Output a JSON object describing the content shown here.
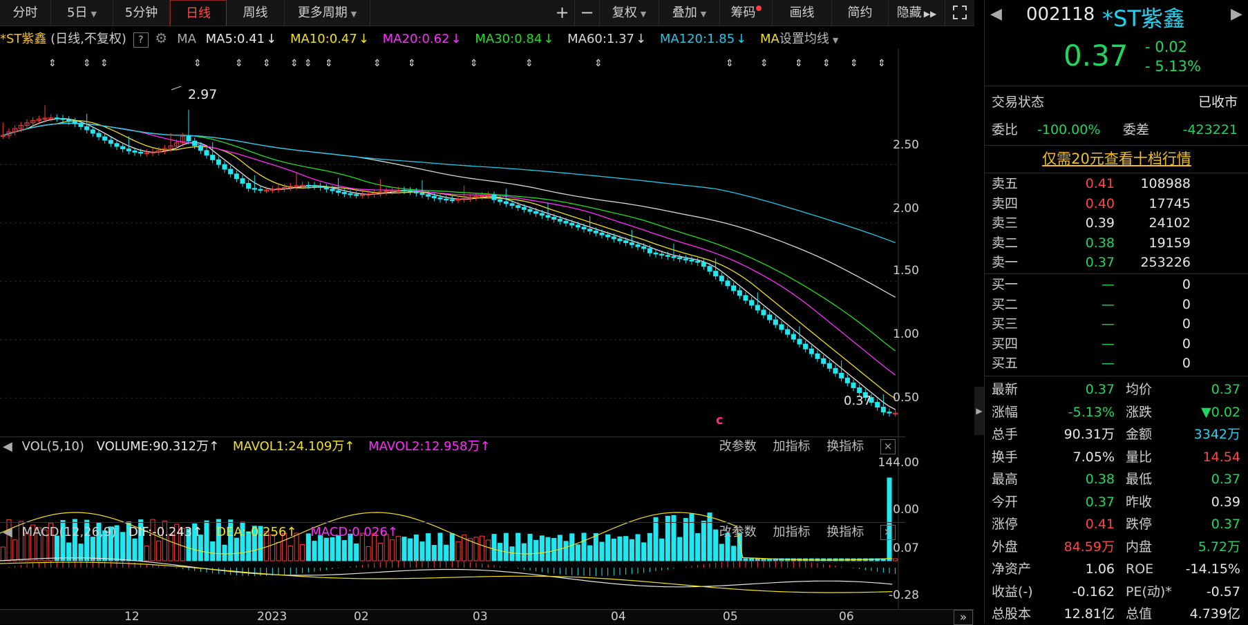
{
  "toolbar": {
    "items": [
      "分时",
      "5日",
      "5分钟",
      "日线",
      "周线",
      "更多周期"
    ],
    "actions": [
      "复权",
      "叠加",
      "筹码",
      "画线",
      "简约",
      "隐藏"
    ],
    "plus": "+",
    "minus": "−"
  },
  "ma_line": {
    "title": "*ST紫鑫",
    "mode": "(日线,不复权)",
    "help": "?",
    "ma_label": "MA",
    "ma5": "MA5:0.41",
    "ma10": "MA10:0.47",
    "ma20": "MA20:0.62",
    "ma30": "MA30:0.84",
    "ma60": "MA60:1.37",
    "ma120": "MA120:1.85",
    "ma_more": "MA",
    "settings": "设置均线",
    "down_arrow": "↓"
  },
  "price_axis": [
    "2.50",
    "2.00",
    "1.50",
    "1.00",
    "0.50"
  ],
  "annotations": {
    "high": "2.97",
    "last": "0.37",
    "marker": "c"
  },
  "volume_panel": {
    "name": "VOL(5,10)",
    "volume": "VOLUME:90.312万",
    "mavol1": "MAVOL1:24.109万",
    "mavol2": "MAVOL2:12.958万",
    "up_arrow": "↑",
    "axis": [
      "144.00",
      "0.00"
    ]
  },
  "macd_panel": {
    "name": "MACD(12,26,9)",
    "dif": "DIF:-0.243",
    "dea": "DEA:-0.256",
    "macd": "MACD:0.026",
    "up_arrow": "↑",
    "axis": [
      "0.07",
      "-0.28"
    ]
  },
  "panel_buttons": [
    "改参数",
    "加指标",
    "换指标"
  ],
  "close_glyph": "×",
  "x_axis": [
    "12",
    "2023",
    "02",
    "03",
    "04",
    "05",
    "06"
  ],
  "sidebar": {
    "code": "002118",
    "name": "*ST紫鑫",
    "price": "0.37",
    "change": "- 0.02",
    "change_pct": "- 5.13%",
    "status_label": "交易状态",
    "status_value": "已收市",
    "weibi_label": "委比",
    "weibi_value": "-100.00%",
    "weicha_label": "委差",
    "weicha_value": "-423221",
    "promo": "仅需20元查看十档行情",
    "sells": [
      {
        "label": "卖五",
        "price": "0.41",
        "vol": "108988",
        "color": "red"
      },
      {
        "label": "卖四",
        "price": "0.40",
        "vol": "17745",
        "color": "red"
      },
      {
        "label": "卖三",
        "price": "0.39",
        "vol": "24102",
        "color": "white"
      },
      {
        "label": "卖二",
        "price": "0.38",
        "vol": "19159",
        "color": "green"
      },
      {
        "label": "卖一",
        "price": "0.37",
        "vol": "253226",
        "color": "green"
      }
    ],
    "buys": [
      {
        "label": "买一",
        "price": "—",
        "vol": "0"
      },
      {
        "label": "买二",
        "price": "—",
        "vol": "0"
      },
      {
        "label": "买三",
        "price": "—",
        "vol": "0"
      },
      {
        "label": "买四",
        "price": "—",
        "vol": "0"
      },
      {
        "label": "买五",
        "price": "—",
        "vol": "0"
      }
    ],
    "stats": [
      {
        "l1": "最新",
        "v1": "0.37",
        "c1": "green",
        "l2": "均价",
        "v2": "0.37",
        "c2": "green"
      },
      {
        "l1": "涨幅",
        "v1": "-5.13%",
        "c1": "green",
        "l2": "涨跌",
        "v2": "▼0.02",
        "c2": "green"
      },
      {
        "l1": "总手",
        "v1": "90.31万",
        "c1": "white",
        "l2": "金额",
        "v2": "3342万",
        "c2": "cyan"
      },
      {
        "l1": "换手",
        "v1": "7.05%",
        "c1": "white",
        "l2": "量比",
        "v2": "14.54",
        "c2": "red"
      },
      {
        "l1": "最高",
        "v1": "0.38",
        "c1": "green",
        "l2": "最低",
        "v2": "0.37",
        "c2": "green"
      },
      {
        "l1": "今开",
        "v1": "0.37",
        "c1": "green",
        "l2": "昨收",
        "v2": "0.39",
        "c2": "white"
      },
      {
        "l1": "涨停",
        "v1": "0.41",
        "c1": "red",
        "l2": "跌停",
        "v2": "0.37",
        "c2": "green"
      },
      {
        "l1": "外盘",
        "v1": "84.59万",
        "c1": "red",
        "l2": "内盘",
        "v2": "5.72万",
        "c2": "green"
      },
      {
        "l1": "净资产",
        "v1": "1.06",
        "c1": "white",
        "l2": "ROE",
        "v2": "-14.15%",
        "c2": "white"
      },
      {
        "l1": "收益(-)",
        "v1": "-0.162",
        "c1": "white",
        "l2": "PE(动)*",
        "v2": "-0.57",
        "c2": "white"
      },
      {
        "l1": "总股本",
        "v1": "12.81亿",
        "c1": "white",
        "l2": "总值",
        "v2": "4.739亿",
        "c2": "white"
      }
    ]
  },
  "colors": {
    "up": "#ff3b3b",
    "down": "#22e6f0",
    "ma5": "#e8e8e8",
    "ma10": "#f2e21a",
    "ma20": "#ff2bff",
    "ma30": "#1ee01e",
    "ma60": "#d8d8d8",
    "ma120": "#22c8e8"
  }
}
